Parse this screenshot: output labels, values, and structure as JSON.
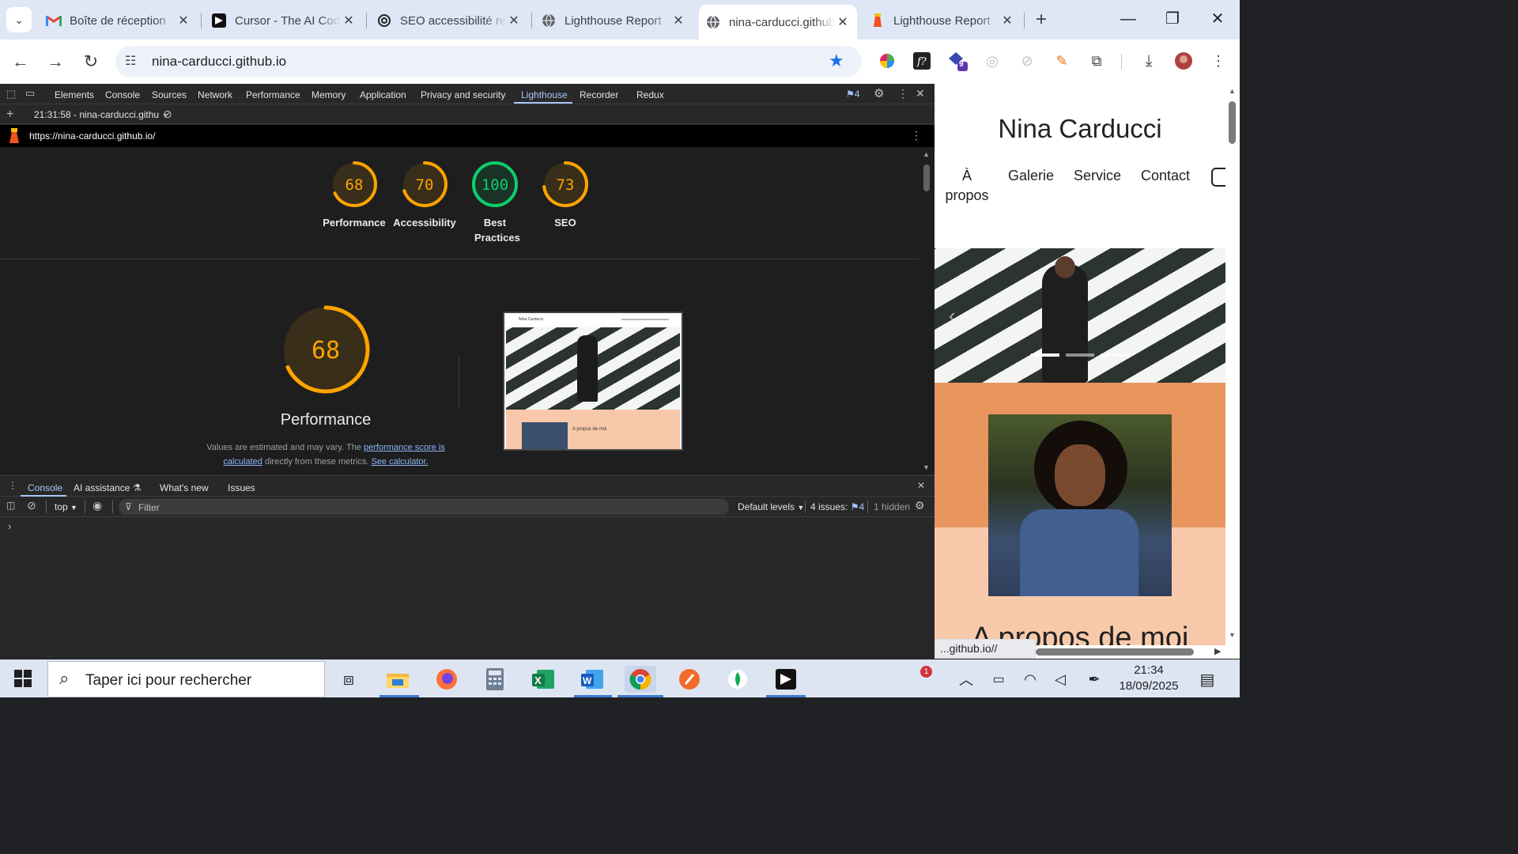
{
  "browser": {
    "tabs": [
      {
        "title": "Boîte de réception",
        "icon": "gmail-icon"
      },
      {
        "title": "Cursor - The AI Code Editor",
        "icon": "cursor-icon"
      },
      {
        "title": "SEO accessibilité re",
        "icon": "openai-icon"
      },
      {
        "title": "Lighthouse Report",
        "icon": "globe-icon"
      },
      {
        "title": "nina-carducci.github.io",
        "icon": "globe-icon",
        "active": true
      },
      {
        "title": "Lighthouse Report",
        "icon": "lighthouse-icon"
      }
    ],
    "new_tab": "+",
    "url": "nina-carducci.github.io",
    "extension_badge": "9",
    "accent": "#1a73e8"
  },
  "devtools": {
    "tabs": [
      "Elements",
      "Console",
      "Sources",
      "Network",
      "Performance",
      "Memory",
      "Application",
      "Privacy and security",
      "Lighthouse",
      "Recorder",
      "Redux"
    ],
    "active_tab": "Lighthouse",
    "issues_count": "4",
    "report_selector": "21:31:58 - nina-carducci.githu",
    "report_url": "https://nina-carducci.github.io/",
    "scores": [
      {
        "label": "Performance",
        "value": "68",
        "score": 68,
        "color": "#ffa400"
      },
      {
        "label": "Accessibility",
        "value": "70",
        "score": 70,
        "color": "#ffa400"
      },
      {
        "label": "Best Practices",
        "value": "100",
        "score": 100,
        "color": "#0cce6b"
      },
      {
        "label": "SEO",
        "value": "73",
        "score": 73,
        "color": "#ffa400"
      }
    ],
    "main_score": {
      "label": "Performance",
      "value": "68",
      "score": 68
    },
    "note": {
      "prefix": "Values are estimated and may vary. The ",
      "link1": "performance score is calculated",
      "middle": " directly from these metrics. ",
      "link2": "See calculator."
    },
    "thumbnail": {
      "title": "Nina Carducci",
      "section": "A propos de moi"
    },
    "drawer": {
      "tabs": [
        "Console",
        "AI assistance",
        "What's new",
        "Issues"
      ],
      "context": "top",
      "filter_placeholder": "Filter",
      "levels": "Default levels",
      "issues_label": "4 issues:",
      "issues_count": "4",
      "hidden": "1 hidden",
      "prompt": "›"
    }
  },
  "site": {
    "title": "Nina Carducci",
    "nav": [
      "À propos",
      "Galerie",
      "Service",
      "Contact"
    ],
    "about_heading": "A propos de moi",
    "status_url": "...github.io//"
  },
  "taskbar": {
    "search_placeholder": "Taper ici pour rechercher",
    "time": "21:34",
    "date": "18/09/2025",
    "notification_badge": "1"
  }
}
